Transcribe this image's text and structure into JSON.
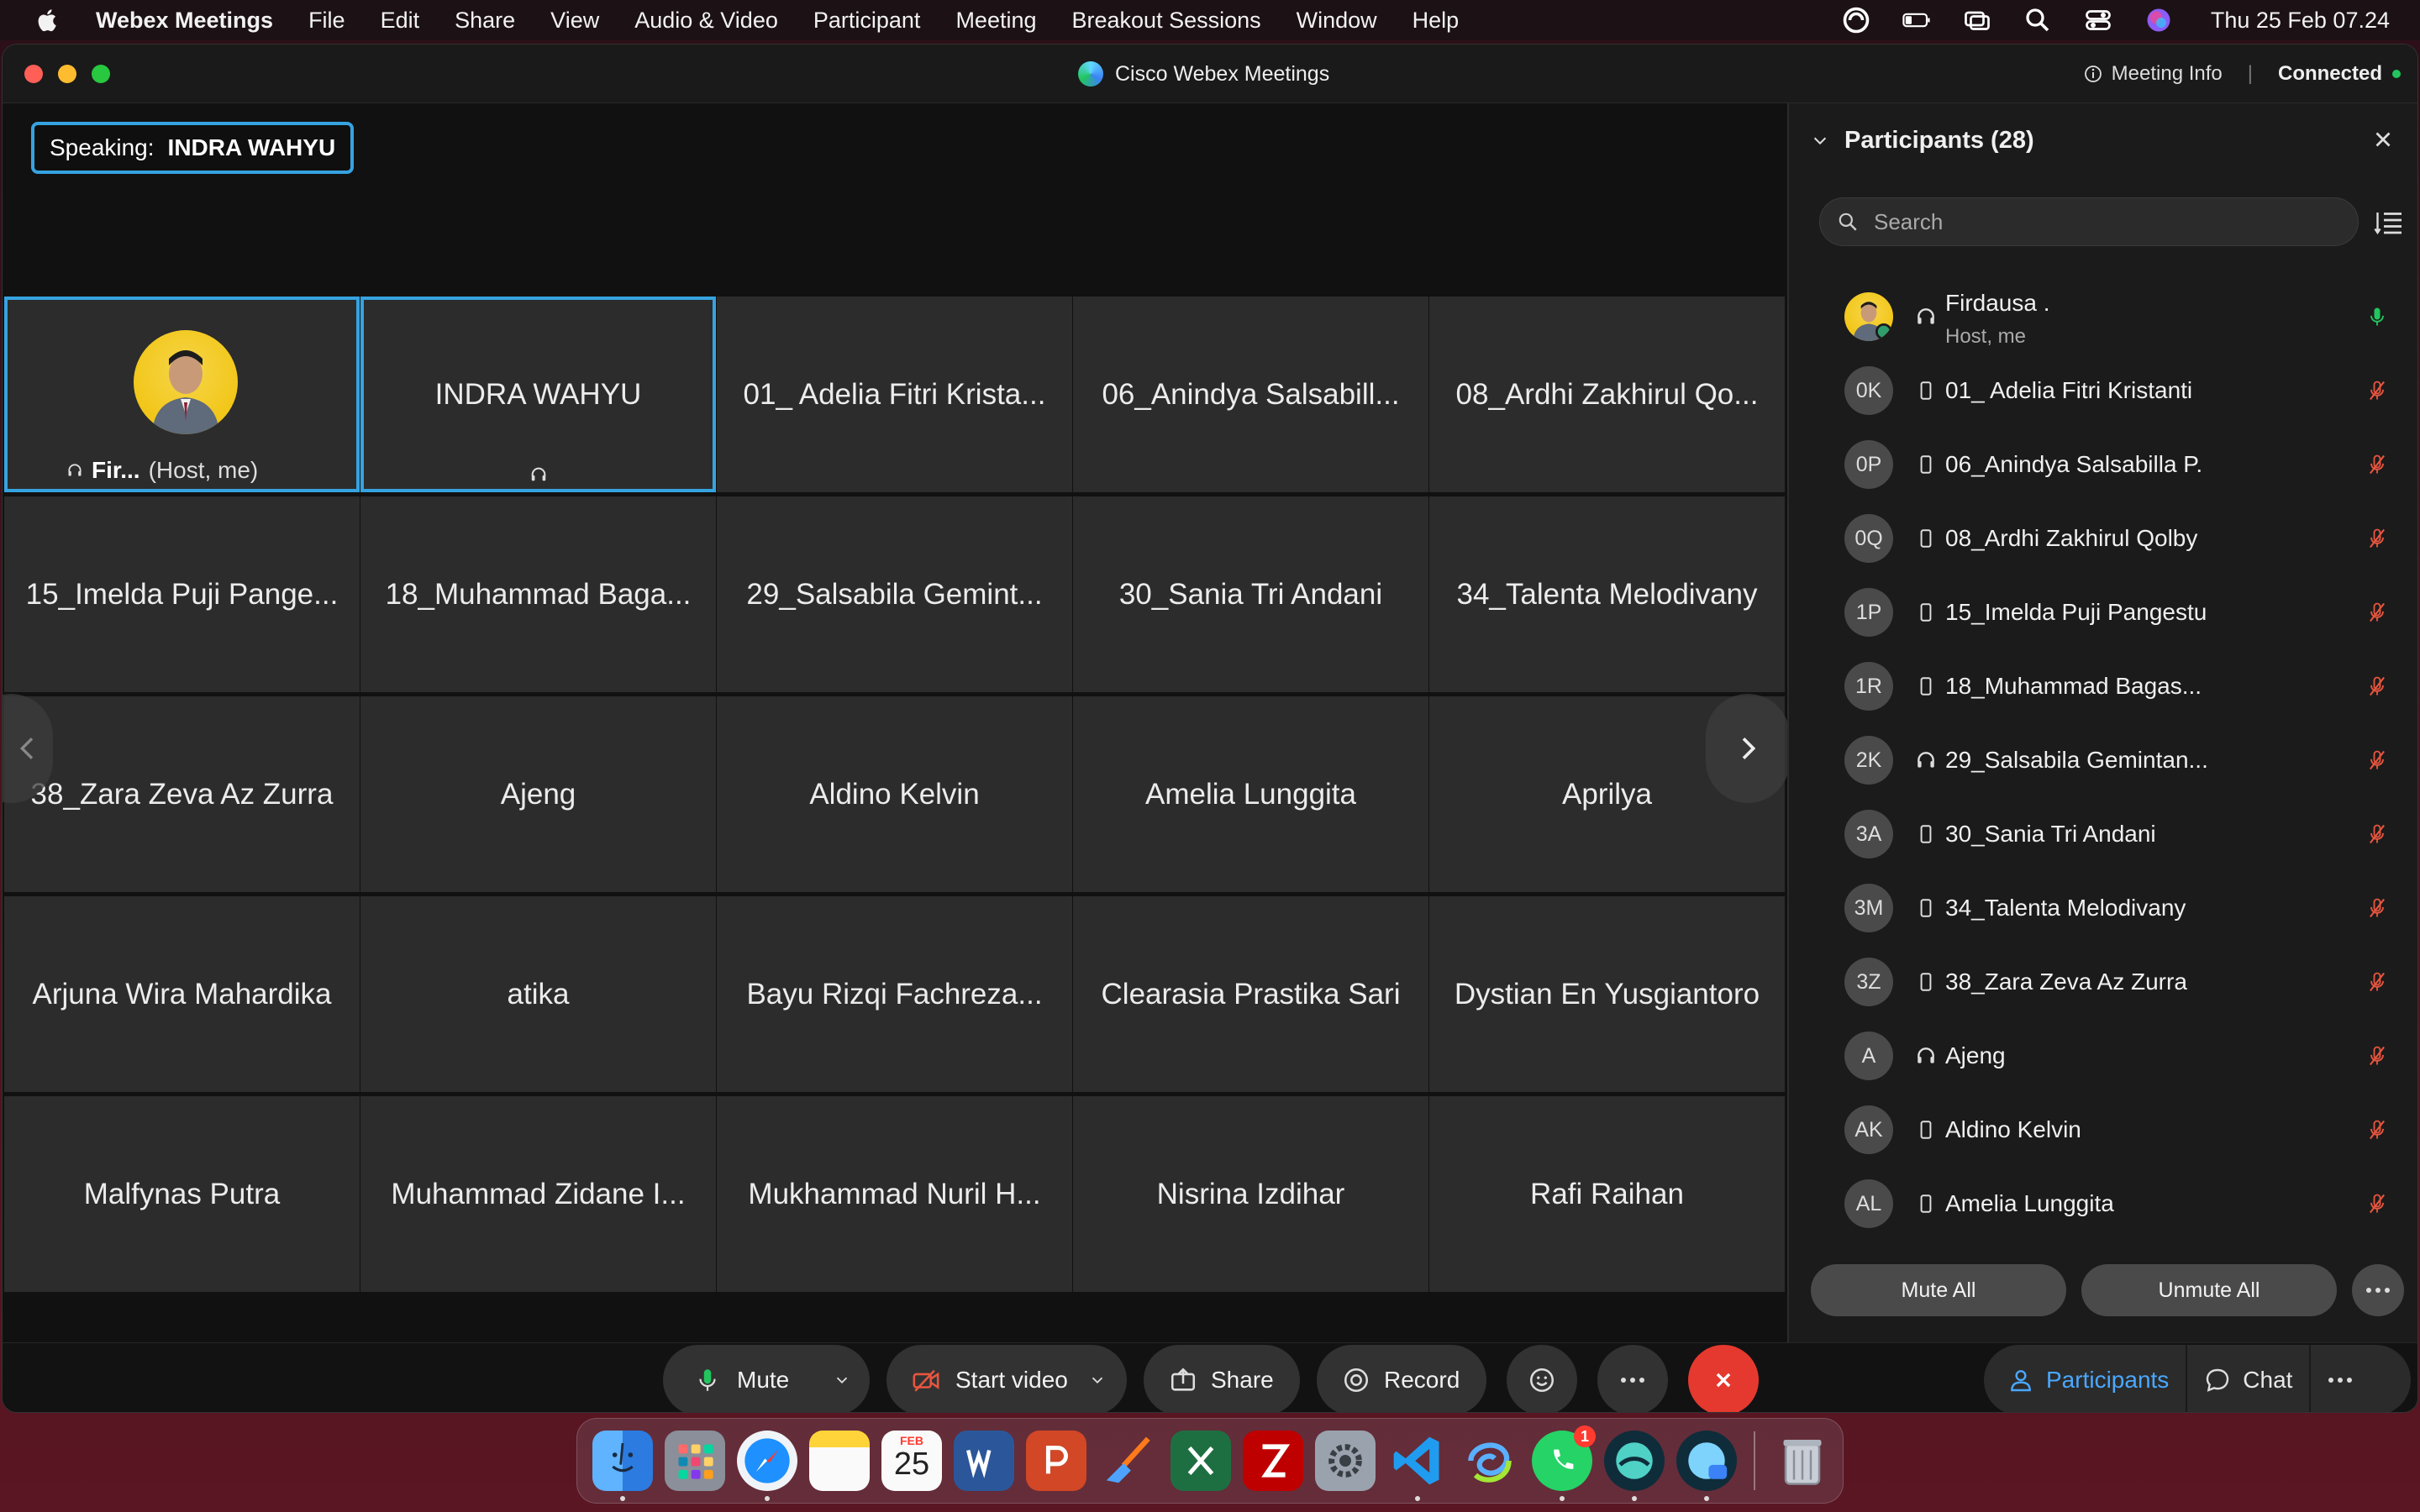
{
  "menubar": {
    "app_name": "Webex Meetings",
    "items": [
      "File",
      "Edit",
      "Share",
      "View",
      "Audio & Video",
      "Participant",
      "Meeting",
      "Breakout Sessions",
      "Window",
      "Help"
    ],
    "clock": "Thu 25 Feb  07.24"
  },
  "window": {
    "title": "Cisco Webex Meetings",
    "meeting_info": "Meeting Info",
    "separator": "|",
    "status": "Connected"
  },
  "speaking": {
    "label": "Speaking:",
    "name": "INDRA WAHYU"
  },
  "tiles": [
    {
      "name": "Fir...",
      "suffix": "(Host, me)",
      "type": "self"
    },
    {
      "name": "INDRA WAHYU",
      "type": "speaker"
    },
    {
      "name": "01_ Adelia Fitri Krista..."
    },
    {
      "name": "06_Anindya Salsabill..."
    },
    {
      "name": "08_Ardhi Zakhirul Qo..."
    },
    {
      "name": "15_Imelda Puji Pange..."
    },
    {
      "name": "18_Muhammad Baga..."
    },
    {
      "name": "29_Salsabila Gemint..."
    },
    {
      "name": "30_Sania Tri Andani"
    },
    {
      "name": "34_Talenta Melodivany"
    },
    {
      "name": "38_Zara Zeva Az Zurra"
    },
    {
      "name": "Ajeng"
    },
    {
      "name": "Aldino Kelvin"
    },
    {
      "name": "Amelia Lunggita"
    },
    {
      "name": "Aprilya"
    },
    {
      "name": "Arjuna Wira Mahardika"
    },
    {
      "name": "atika"
    },
    {
      "name": "Bayu Rizqi Fachreza..."
    },
    {
      "name": "Clearasia Prastika Sari"
    },
    {
      "name": "Dystian En Yusgiantoro"
    },
    {
      "name": "Malfynas Putra"
    },
    {
      "name": "Muhammad Zidane I..."
    },
    {
      "name": "Mukhammad Nuril H..."
    },
    {
      "name": "Nisrina Izdihar"
    },
    {
      "name": "Rafi Raihan"
    }
  ],
  "panel": {
    "title": "Participants (28)",
    "search_placeholder": "Search",
    "participants": [
      {
        "initials": "",
        "name": "Firdausa .",
        "sub": "Host, me",
        "device": "headset",
        "mic": "on"
      },
      {
        "initials": "0K",
        "name": "01_ Adelia Fitri Kristanti",
        "device": "phone",
        "mic": "muted"
      },
      {
        "initials": "0P",
        "name": "06_Anindya Salsabilla P.",
        "device": "phone",
        "mic": "muted"
      },
      {
        "initials": "0Q",
        "name": "08_Ardhi Zakhirul Qolby",
        "device": "phone",
        "mic": "muted"
      },
      {
        "initials": "1P",
        "name": "15_Imelda Puji Pangestu",
        "device": "phone",
        "mic": "muted"
      },
      {
        "initials": "1R",
        "name": "18_Muhammad Bagas...",
        "device": "phone",
        "mic": "muted"
      },
      {
        "initials": "2K",
        "name": "29_Salsabila Gemintan...",
        "device": "headset",
        "mic": "muted"
      },
      {
        "initials": "3A",
        "name": "30_Sania Tri Andani",
        "device": "phone",
        "mic": "muted"
      },
      {
        "initials": "3M",
        "name": "34_Talenta Melodivany",
        "device": "phone",
        "mic": "muted"
      },
      {
        "initials": "3Z",
        "name": "38_Zara Zeva Az Zurra",
        "device": "phone",
        "mic": "muted"
      },
      {
        "initials": "A",
        "name": "Ajeng",
        "device": "headset",
        "mic": "muted"
      },
      {
        "initials": "AK",
        "name": "Aldino Kelvin",
        "device": "phone",
        "mic": "muted"
      },
      {
        "initials": "AL",
        "name": "Amelia Lunggita",
        "device": "phone",
        "mic": "muted"
      }
    ],
    "mute_all": "Mute All",
    "unmute_all": "Unmute All"
  },
  "controls": {
    "mute": "Mute",
    "start_video": "Start video",
    "share": "Share",
    "record": "Record",
    "participants": "Participants",
    "chat": "Chat"
  },
  "dock": {
    "calendar_month": "FEB",
    "calendar_day": "25",
    "whatsapp_badge": "1"
  },
  "colors": {
    "accent_blue": "#36a3e0",
    "end_red": "#e5392f",
    "muted_red": "#e8553f",
    "mic_on_green": "#22c55e"
  }
}
